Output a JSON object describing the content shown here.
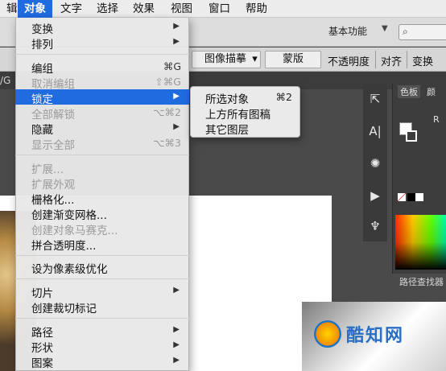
{
  "menubar": {
    "items": [
      {
        "label": "辑"
      },
      {
        "label": "对象"
      },
      {
        "label": "文字"
      },
      {
        "label": "选择"
      },
      {
        "label": "效果"
      },
      {
        "label": "视图"
      },
      {
        "label": "窗口"
      },
      {
        "label": "帮助"
      }
    ]
  },
  "app_header": {
    "workspace": "基本功能",
    "search_icon": "search-icon"
  },
  "control_bar": {
    "image_trace": "图像描摹",
    "mask": "蒙版",
    "opacity": "不透明度",
    "align": "对齐",
    "transform": "变换"
  },
  "document_tab": {
    "fragment": "/G"
  },
  "object_menu": {
    "items": [
      {
        "label": "变换",
        "submenu": "▶"
      },
      {
        "label": "排列",
        "submenu": "▶"
      },
      {
        "label": "编组",
        "shortcut": "⌘G"
      },
      {
        "label": "取消编组",
        "shortcut": "⇧⌘G",
        "disabled": true
      },
      {
        "label": "锁定",
        "submenu": "▶",
        "highlighted": true
      },
      {
        "label": "全部解锁",
        "shortcut": "⌥⌘2",
        "disabled": true
      },
      {
        "label": "隐藏",
        "submenu": "▶"
      },
      {
        "label": "显示全部",
        "shortcut": "⌥⌘3",
        "disabled": true
      },
      {
        "label": "扩展...",
        "disabled": true
      },
      {
        "label": "扩展外观",
        "disabled": true
      },
      {
        "label": "栅格化..."
      },
      {
        "label": "创建渐变网格..."
      },
      {
        "label": "创建对象马赛克...",
        "disabled": true
      },
      {
        "label": "拼合透明度..."
      },
      {
        "label": "设为像素级优化"
      },
      {
        "label": "切片",
        "submenu": "▶"
      },
      {
        "label": "创建裁切标记"
      },
      {
        "label": "路径",
        "submenu": "▶"
      },
      {
        "label": "形状",
        "submenu": "▶"
      },
      {
        "label": "图案",
        "submenu": "▶"
      }
    ]
  },
  "lock_submenu": {
    "items": [
      {
        "label": "所选对象",
        "shortcut": "⌘2"
      },
      {
        "label": "上方所有图稿"
      },
      {
        "label": "其它图层"
      }
    ]
  },
  "color_panel": {
    "tab_swatches": "色板",
    "tab_color": "颜",
    "r_label": "R",
    "path_finder": "路径查找器"
  },
  "artwork": {
    "text": "酷知网"
  }
}
